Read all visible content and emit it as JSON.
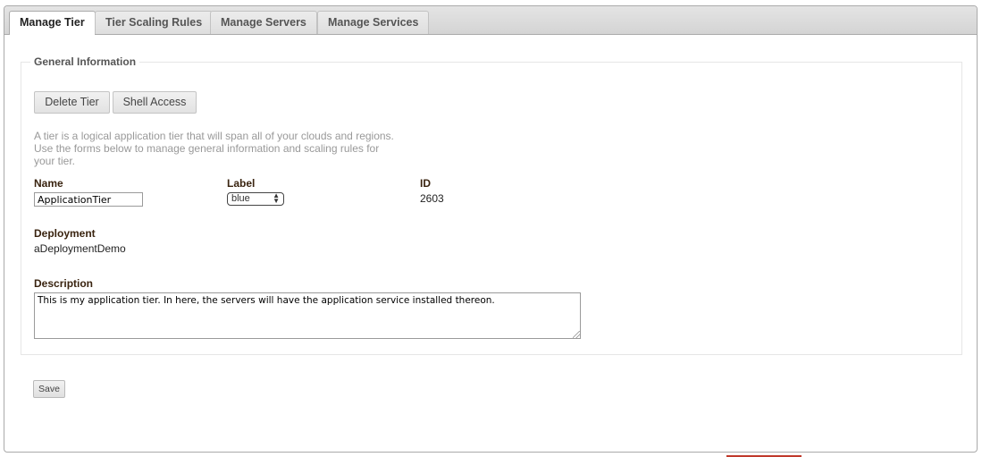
{
  "tabs": [
    {
      "label": "Manage Tier",
      "active": true
    },
    {
      "label": "Tier Scaling Rules",
      "active": false
    },
    {
      "label": "Manage Servers",
      "active": false
    },
    {
      "label": "Manage Services",
      "active": false
    }
  ],
  "general": {
    "legend": "General Information",
    "delete_label": "Delete Tier",
    "shell_label": "Shell Access",
    "help_text": "A tier is a logical application tier that will span all of your clouds and regions. Use the forms below to manage general information and scaling rules for your tier."
  },
  "form": {
    "name_label": "Name",
    "name_value": "ApplicationTier",
    "label_label": "Label",
    "label_selected": "blue",
    "id_label": "ID",
    "id_value": "2603",
    "deployment_label": "Deployment",
    "deployment_value": "aDeploymentDemo",
    "description_label": "Description",
    "description_value": "This is my application tier. In here, the servers will have the application service installed thereon."
  },
  "actions": {
    "save_label": "Save"
  },
  "colors": {
    "label_text": "#3a2410",
    "help_text": "#999999",
    "accent_line": "#c0392b"
  }
}
